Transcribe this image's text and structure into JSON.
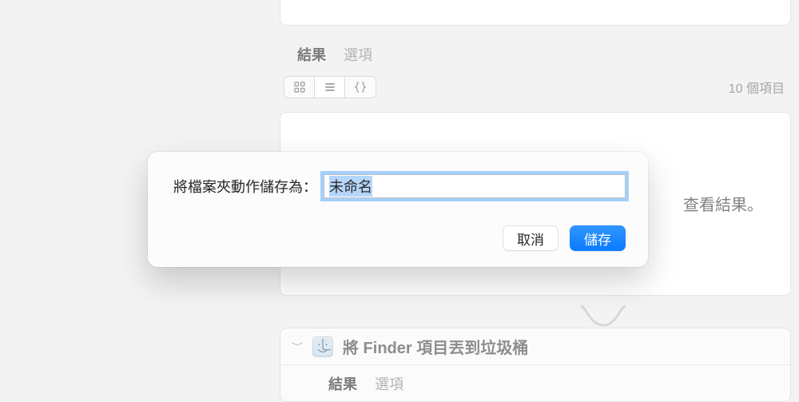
{
  "dialog": {
    "label": "將檔案夾動作儲存為：",
    "filename": "未命名",
    "cancel": "取消",
    "save": "儲存"
  },
  "background": {
    "tabs": {
      "results": "結果",
      "options": "選項"
    },
    "item_count": "10 個項目",
    "see_results": "查看結果。",
    "action2_title": "將 Finder 項目丟到垃圾桶"
  },
  "colors": {
    "accent": "#0a7bff",
    "focus_ring": "rgba(0,122,255,0.35)"
  }
}
